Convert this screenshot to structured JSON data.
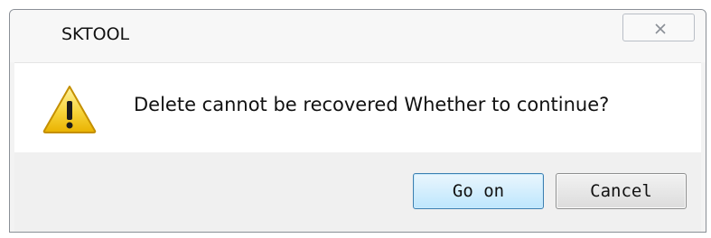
{
  "dialog": {
    "title": "SKTOOL",
    "message": "Delete cannot be recovered Whether to continue?",
    "icon": "warning-icon",
    "close_icon": "close-icon",
    "buttons": {
      "primary_label": "Go on",
      "secondary_label": "Cancel"
    }
  }
}
